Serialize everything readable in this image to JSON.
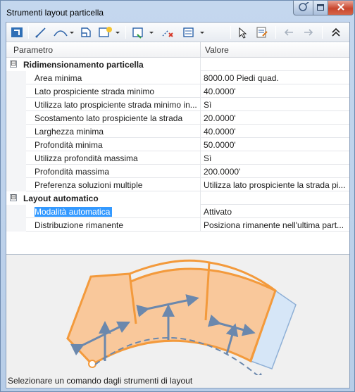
{
  "window": {
    "title": "Strumenti layout particella",
    "help_icon": "help-icon",
    "maximize_icon": "maximize-icon",
    "close_icon": "close-icon",
    "close_color": "#c8462e"
  },
  "toolbar": {
    "tools": [
      "layout-icon",
      "line-icon",
      "arc-icon",
      "frontage-icon",
      "new-lot-icon",
      "lot-options-icon",
      "delete-sub-icon",
      "parcel-options-icon",
      "pick-icon",
      "edit-icon",
      "undo-icon",
      "redo-icon",
      "collapse-icon"
    ]
  },
  "grid": {
    "col_param": "Parametro",
    "col_value": "Valore",
    "categories": [
      {
        "label": "Ridimensionamento particella",
        "expander": "⊟",
        "rows": [
          {
            "name": "Area minima",
            "value": "8000.00 Piedi quad."
          },
          {
            "name": "Lato prospiciente strada minimo",
            "value": "40.0000'"
          },
          {
            "name": "Utilizza lato prospiciente strada minimo in...",
            "value": "Sì"
          },
          {
            "name": "Scostamento lato prospiciente la strada",
            "value": "20.0000'"
          },
          {
            "name": "Larghezza minima",
            "value": "40.0000'"
          },
          {
            "name": "Profondità minima",
            "value": "50.0000'"
          },
          {
            "name": "Utilizza profondità massima",
            "value": "Sì"
          },
          {
            "name": "Profondità massima",
            "value": "200.0000'"
          },
          {
            "name": "Preferenza soluzioni multiple",
            "value": "Utilizza lato prospiciente la strada pi..."
          }
        ]
      },
      {
        "label": "Layout automatico",
        "expander": "⊟",
        "rows": [
          {
            "name": "Modalità automatica",
            "value": "Attivato",
            "selected": true
          },
          {
            "name": "Distribuzione rimanente",
            "value": "Posiziona rimanente nell'ultima part..."
          }
        ]
      }
    ]
  },
  "preview": {
    "lot_fill": "#f9c89b",
    "lot_stroke": "#f39a3c",
    "remnant_fill": "#d6e6f7",
    "arrow_color": "#6b88ad"
  },
  "status": {
    "text": "Selezionare un comando dagli strumenti di layout"
  }
}
